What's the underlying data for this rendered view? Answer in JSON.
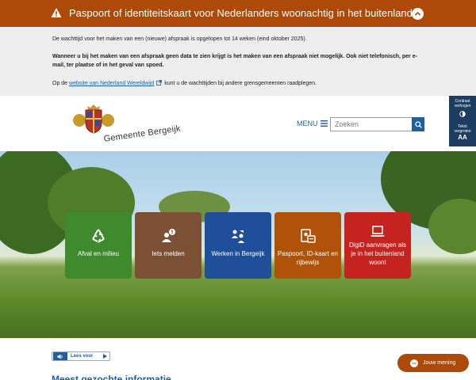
{
  "alert": {
    "title": "Paspoort of identiteitskaart voor Nederlanders woonachtig in het buitenland",
    "paragraph1": "De wachttijd voor het maken van een (nieuwe) afspraak is opgelopen tot 14 weken (eind oktober 2025).",
    "paragraph2": "Wanneer u bij het maken van een afspraak geen data te zien krijgt is het maken van een afspraak niet mogelijk. Ook niet telefonisch, per e-mail, ter plaatse of in het geval van spoed.",
    "paragraph3_before": "Op de",
    "paragraph3_link": "website van Nederland Wereldwijd",
    "paragraph3_after": "kunt u de wachttijden bij andere grensgemeenten raadplegen.",
    "background_color": "#ad4a09",
    "icon": "warning-icon"
  },
  "header": {
    "logo_text": "Gemeente Bergeijk",
    "menu_label": "MENU",
    "search_placeholder": "Zoeken"
  },
  "accessibility": {
    "contrast_label": "Contrast verhogen",
    "text_label": "Tekst vergroten",
    "text_glyph": "AA"
  },
  "tiles": [
    {
      "label": "Afval en milieu",
      "color": "#3f8a2c",
      "icon": "recycle-icon"
    },
    {
      "label": "Iets melden",
      "color": "#7b5035",
      "icon": "report-person-icon"
    },
    {
      "label": "Werken in Bergeijk",
      "color": "#1f4f99",
      "icon": "people-icon"
    },
    {
      "label": "Paspoort, ID-kaart en rijbewijs",
      "color": "#b0520a",
      "icon": "id-card-icon"
    },
    {
      "label": "DigiD aanvragen als je in het buitenland woont",
      "color": "#c62320",
      "icon": "laptop-icon"
    }
  ],
  "readspeaker": {
    "label": "Lees voor"
  },
  "section_title": "Meest gezochte informatie",
  "appointment_button": {
    "label": "Jouw mening"
  }
}
